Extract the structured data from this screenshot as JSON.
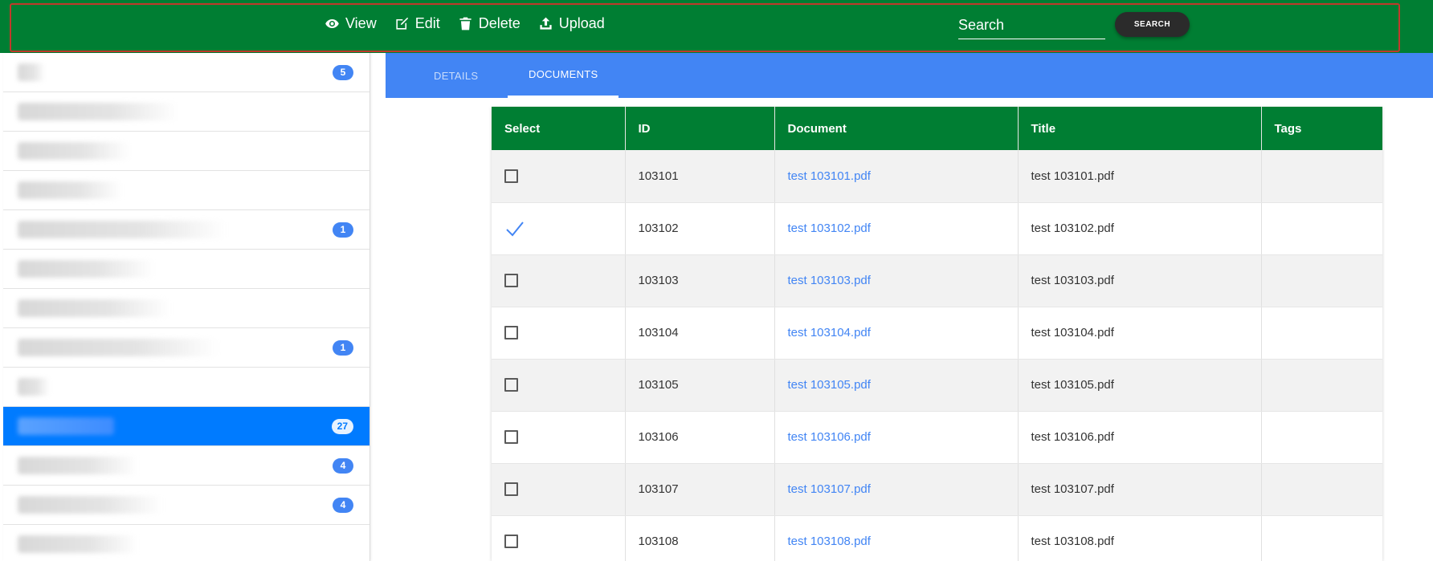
{
  "toolbar": {
    "actions": [
      {
        "label": "View",
        "icon": "eye-icon"
      },
      {
        "label": "Edit",
        "icon": "edit-icon"
      },
      {
        "label": "Delete",
        "icon": "trash-icon"
      },
      {
        "label": "Upload",
        "icon": "upload-icon"
      }
    ],
    "search_placeholder": "Search",
    "search_button": "SEARCH",
    "colors": {
      "bar": "#007e33",
      "outline": "#c0392b",
      "button": "#2b2b2b"
    }
  },
  "sidebar": {
    "items": [
      {
        "badge": "5",
        "active": false
      },
      {
        "badge": "",
        "active": false
      },
      {
        "badge": "",
        "active": false
      },
      {
        "badge": "",
        "active": false
      },
      {
        "badge": "1",
        "active": false
      },
      {
        "badge": "",
        "active": false
      },
      {
        "badge": "",
        "active": false
      },
      {
        "badge": "1",
        "active": false
      },
      {
        "badge": "",
        "active": false
      },
      {
        "badge": "27",
        "active": true
      },
      {
        "badge": "4",
        "active": false
      },
      {
        "badge": "4",
        "active": false
      },
      {
        "badge": "",
        "active": false
      }
    ],
    "colors": {
      "active": "#007bff",
      "badge": "#4285f4"
    }
  },
  "tabs": [
    {
      "label": "DETAILS",
      "active": false
    },
    {
      "label": "DOCUMENTS",
      "active": true
    }
  ],
  "table": {
    "headers": [
      "Select",
      "ID",
      "Document",
      "Title",
      "Tags"
    ],
    "rows": [
      {
        "selected": false,
        "id": "103101",
        "document": "test 103101.pdf",
        "title": "test 103101.pdf",
        "tags": ""
      },
      {
        "selected": true,
        "id": "103102",
        "document": "test 103102.pdf",
        "title": "test 103102.pdf",
        "tags": ""
      },
      {
        "selected": false,
        "id": "103103",
        "document": "test 103103.pdf",
        "title": "test 103103.pdf",
        "tags": ""
      },
      {
        "selected": false,
        "id": "103104",
        "document": "test 103104.pdf",
        "title": "test 103104.pdf",
        "tags": ""
      },
      {
        "selected": false,
        "id": "103105",
        "document": "test 103105.pdf",
        "title": "test 103105.pdf",
        "tags": ""
      },
      {
        "selected": false,
        "id": "103106",
        "document": "test 103106.pdf",
        "title": "test 103106.pdf",
        "tags": ""
      },
      {
        "selected": false,
        "id": "103107",
        "document": "test 103107.pdf",
        "title": "test 103107.pdf",
        "tags": ""
      },
      {
        "selected": false,
        "id": "103108",
        "document": "test 103108.pdf",
        "title": "test 103108.pdf",
        "tags": ""
      }
    ],
    "colors": {
      "header": "#007e33",
      "link": "#4285f4",
      "check": "#4285f4"
    }
  }
}
